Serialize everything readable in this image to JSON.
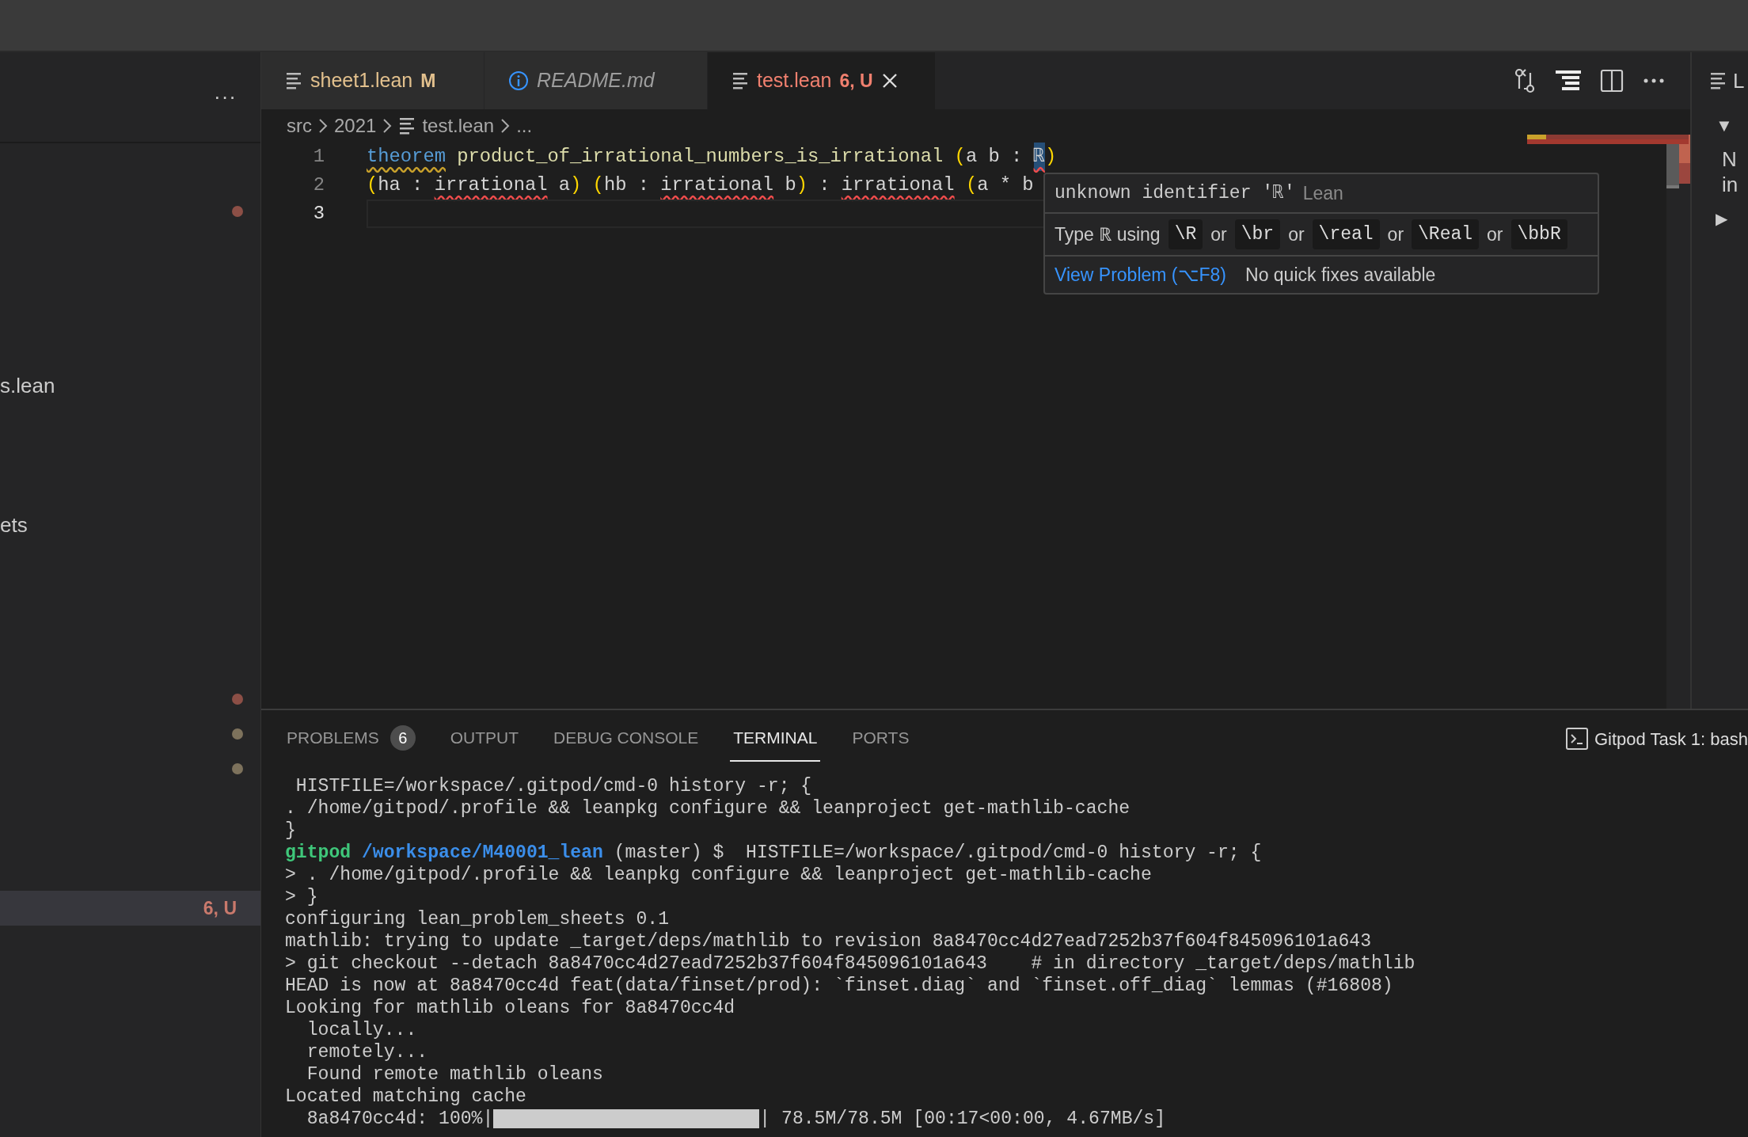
{
  "explorer": {
    "more": "···",
    "rows": [
      {
        "kind": "dot",
        "color": "#8c4f46"
      },
      {
        "kind": "label",
        "text": "s.lean"
      },
      {
        "kind": "label",
        "text": "ets"
      },
      {
        "kind": "dot",
        "color": "#8c4f46"
      },
      {
        "kind": "dot",
        "color": "#7d725c"
      },
      {
        "kind": "dot",
        "color": "#7d725c"
      },
      {
        "kind": "status",
        "text": "6, U",
        "selected": true
      }
    ]
  },
  "tabs": [
    {
      "label": "sheet1.lean",
      "badge": "M",
      "kind": "modified",
      "selected": false
    },
    {
      "label": "README.md",
      "kind": "preview",
      "selected": false
    },
    {
      "label": "test.lean",
      "badge": "6, U",
      "kind": "error",
      "selected": true
    }
  ],
  "breadcrumbs": [
    {
      "text": "src",
      "kind": "folder"
    },
    {
      "text": "2021",
      "kind": "folder"
    },
    {
      "text": "test.lean",
      "kind": "file"
    },
    {
      "text": "...",
      "kind": "more"
    }
  ],
  "lines": [
    {
      "number": "1",
      "current": false,
      "tokens": [
        {
          "text": "theorem",
          "kind": "keyword",
          "warning": true
        },
        {
          "text": " product_of_irrational_numbers_is_irrational",
          "kind": "function"
        },
        {
          "text": " (",
          "kind": "bracket"
        },
        {
          "text": "a b : ",
          "kind": "text"
        },
        {
          "text": "ℝ",
          "kind": "text",
          "error": true,
          "highlight": true
        },
        {
          "text": ")",
          "kind": "bracket"
        }
      ]
    },
    {
      "number": "2",
      "current": false,
      "tokens": [
        {
          "text": "(",
          "kind": "bracket"
        },
        {
          "text": "ha : ",
          "kind": "text"
        },
        {
          "text": "irrational",
          "kind": "text",
          "error": true
        },
        {
          "text": " a",
          "kind": "text"
        },
        {
          "text": ")",
          "kind": "bracket"
        },
        {
          "text": " (",
          "kind": "bracket"
        },
        {
          "text": "hb : ",
          "kind": "text"
        },
        {
          "text": "irrational",
          "kind": "text",
          "error": true
        },
        {
          "text": " b",
          "kind": "text"
        },
        {
          "text": ")",
          "kind": "bracket"
        },
        {
          "text": " : ",
          "kind": "text"
        },
        {
          "text": "irrational",
          "kind": "text",
          "error": true
        },
        {
          "text": " (",
          "kind": "bracket"
        },
        {
          "text": "a * b",
          "kind": "text"
        }
      ]
    },
    {
      "number": "3",
      "current": true
    }
  ],
  "hover": {
    "message": "unknown identifier 'ℝ'",
    "source": "Lean",
    "hint": [
      {
        "text": "Type ℝ using",
        "kind": "text"
      },
      {
        "text": "\\R",
        "kind": "code"
      },
      {
        "text": "or",
        "kind": "text"
      },
      {
        "text": "\\br",
        "kind": "code"
      },
      {
        "text": "or",
        "kind": "text"
      },
      {
        "text": "\\real",
        "kind": "code"
      },
      {
        "text": "or",
        "kind": "text"
      },
      {
        "text": "\\Real",
        "kind": "code"
      },
      {
        "text": "or",
        "kind": "text"
      },
      {
        "text": "\\bbR",
        "kind": "code"
      }
    ],
    "action": "View Problem (⌥F8)",
    "note": "No quick fixes available"
  },
  "outline": {
    "title": "L",
    "toggles": [
      {
        "text": "▼",
        "expanded": true
      },
      {
        "text": "▶",
        "expanded": false
      }
    ],
    "texts": [
      "N",
      "in"
    ]
  },
  "panel": {
    "tabs": [
      {
        "label": "PROBLEMS",
        "count": "6",
        "selected": false
      },
      {
        "label": "OUTPUT",
        "selected": false
      },
      {
        "label": "DEBUG CONSOLE",
        "selected": false
      },
      {
        "label": "TERMINAL",
        "selected": true
      },
      {
        "label": "PORTS",
        "selected": false
      }
    ],
    "task": "Gitpod Task 1: bash",
    "terminal": [
      {
        "kind": "text",
        "segments": [
          {
            "text": " HISTFILE=/workspace/.gitpod/cmd-0 history -r; {",
            "kind": "plain"
          }
        ]
      },
      {
        "kind": "text",
        "segments": [
          {
            "text": ". /home/gitpod/.profile && leanpkg configure && leanproject get-mathlib-cache",
            "kind": "plain"
          }
        ]
      },
      {
        "kind": "text",
        "segments": [
          {
            "text": "}",
            "kind": "plain"
          }
        ]
      },
      {
        "kind": "text",
        "segments": [
          {
            "text": "gitpod ",
            "kind": "user"
          },
          {
            "text": "/workspace/M40001_lean",
            "kind": "path"
          },
          {
            "text": " (master) $  HISTFILE=/workspace/.gitpod/cmd-0 history -r; {",
            "kind": "plain"
          }
        ]
      },
      {
        "kind": "text",
        "segments": [
          {
            "text": "> . /home/gitpod/.profile && leanpkg configure && leanproject get-mathlib-cache",
            "kind": "plain"
          }
        ]
      },
      {
        "kind": "text",
        "segments": [
          {
            "text": "> }",
            "kind": "plain"
          }
        ]
      },
      {
        "kind": "text",
        "segments": [
          {
            "text": "configuring lean_problem_sheets 0.1",
            "kind": "plain"
          }
        ]
      },
      {
        "kind": "text",
        "segments": [
          {
            "text": "mathlib: trying to update _target/deps/mathlib to revision 8a8470cc4d27ead7252b37f604f845096101a643",
            "kind": "plain"
          }
        ]
      },
      {
        "kind": "text",
        "segments": [
          {
            "text": "> git checkout --detach 8a8470cc4d27ead7252b37f604f845096101a643    # in directory _target/deps/mathlib",
            "kind": "plain"
          }
        ]
      },
      {
        "kind": "text",
        "segments": [
          {
            "text": "HEAD is now at 8a8470cc4d feat(data/finset/prod): `finset.diag` and `finset.off_diag` lemmas (#16808)",
            "kind": "plain"
          }
        ]
      },
      {
        "kind": "text",
        "segments": [
          {
            "text": "Looking for mathlib oleans for 8a8470cc4d",
            "kind": "plain"
          }
        ]
      },
      {
        "kind": "text",
        "segments": [
          {
            "text": "  locally...",
            "kind": "plain"
          }
        ]
      },
      {
        "kind": "text",
        "segments": [
          {
            "text": "  remotely...",
            "kind": "plain"
          }
        ]
      },
      {
        "kind": "text",
        "segments": [
          {
            "text": "  Found remote mathlib oleans",
            "kind": "plain"
          }
        ]
      },
      {
        "kind": "text",
        "segments": [
          {
            "text": "Located matching cache",
            "kind": "plain"
          }
        ]
      },
      {
        "kind": "progress",
        "prefix": "  8a8470cc4d: 100%|",
        "level": 1,
        "suffix": "| 78.5M/78.5M [00:17<00:00, 4.67MB/s]"
      }
    ]
  }
}
